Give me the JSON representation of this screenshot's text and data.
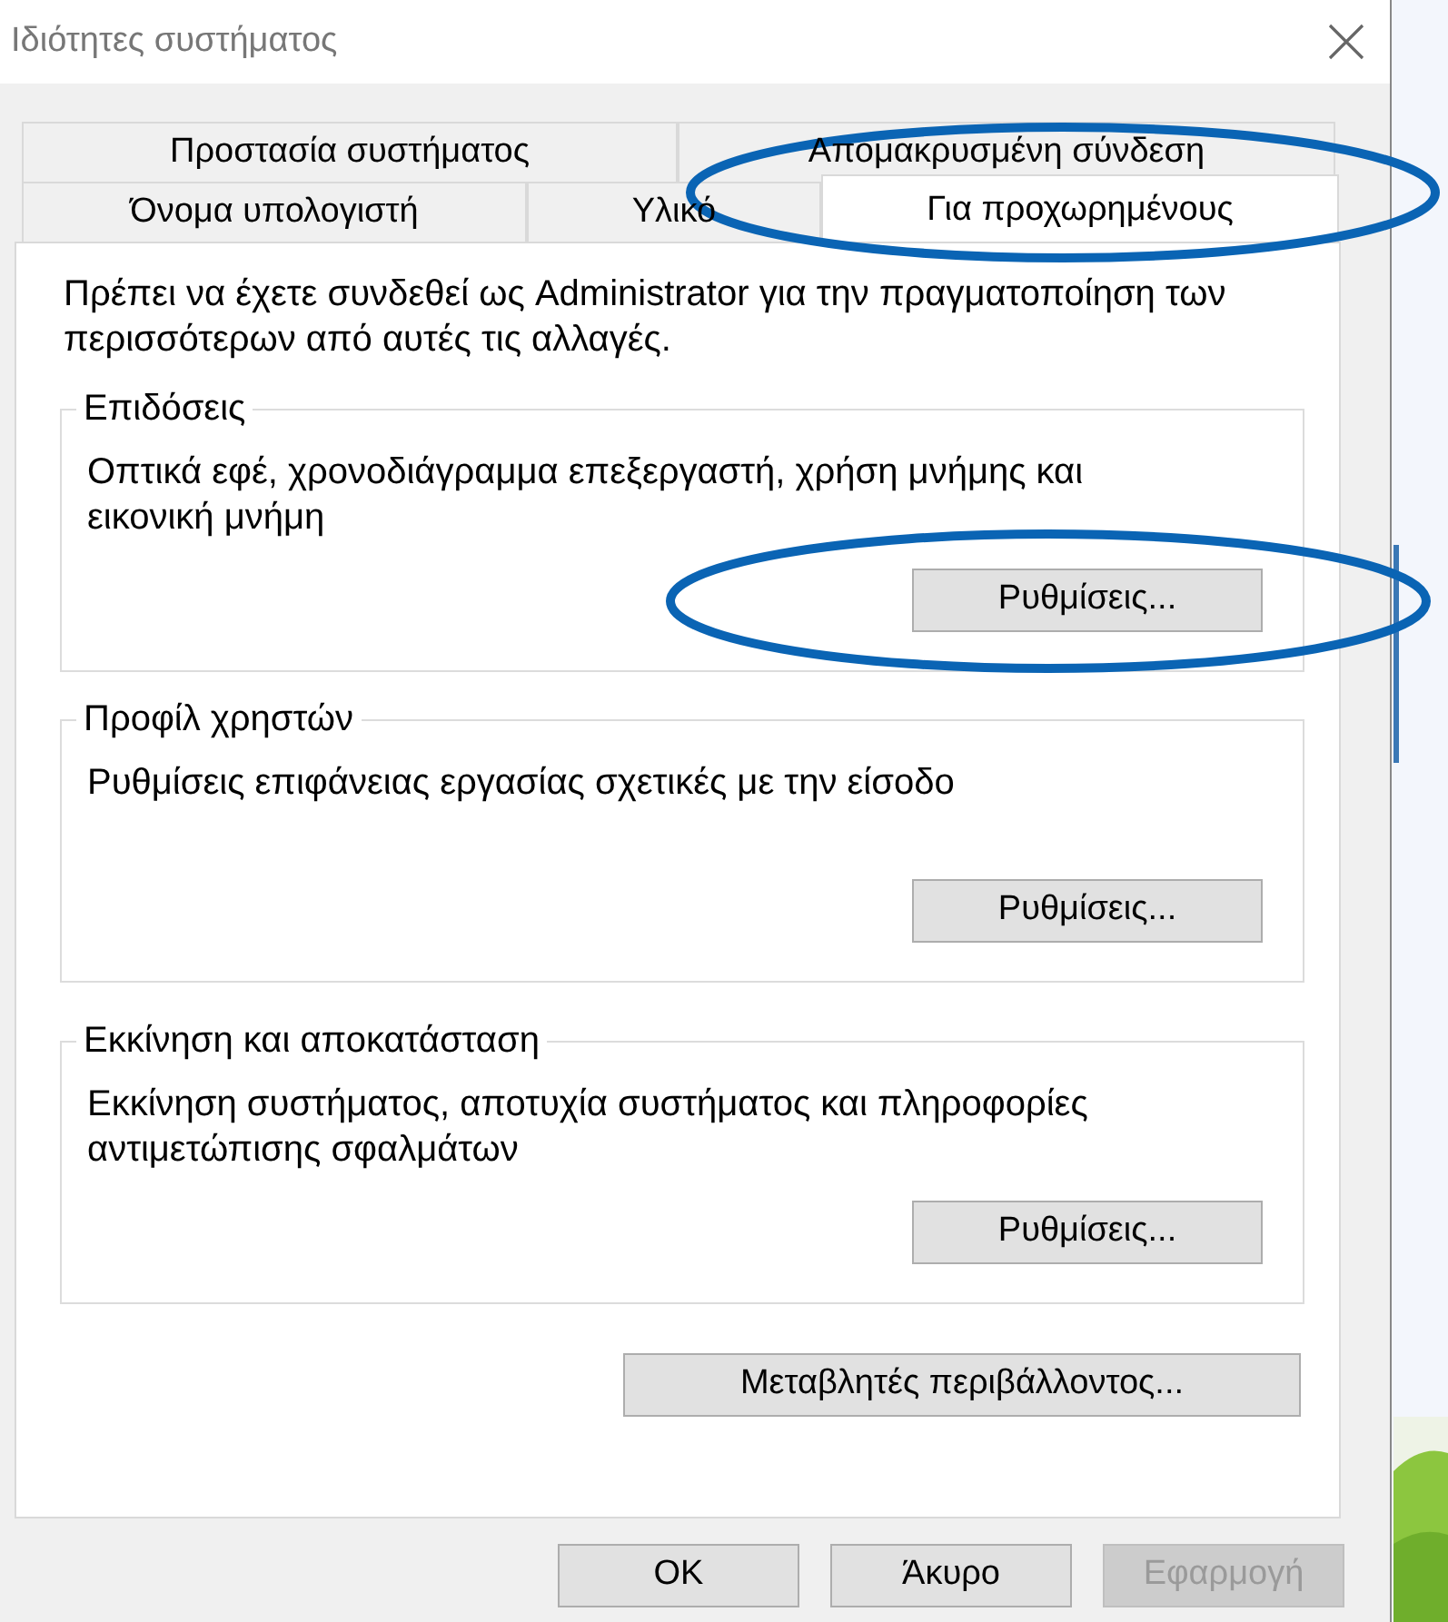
{
  "window": {
    "title": "Ιδιότητες συστήματος"
  },
  "tab_rows": [
    [
      {
        "label": "Προστασία συστήματος",
        "selected": false,
        "highlighted": false
      },
      {
        "label": "Απομακρυσμένη σύνδεση",
        "selected": false,
        "highlighted": false
      }
    ],
    [
      {
        "label": "Όνομα υπολογιστή",
        "selected": false,
        "highlighted": false
      },
      {
        "label": "Υλικό",
        "selected": false,
        "highlighted": false
      },
      {
        "label": "Για προχωρημένους",
        "selected": true,
        "highlighted": true
      }
    ]
  ],
  "intro": "Πρέπει να έχετε συνδεθεί ως Administrator για την πραγματοποίηση των περισσότερων από αυτές τις αλλαγές.",
  "groups": [
    {
      "title": "Επιδόσεις",
      "description": "Οπτικά εφέ, χρονοδιάγραμμα επεξεργαστή, χρήση μνήμης και εικονική μνήμη",
      "button": "Ρυθμίσεις...",
      "highlighted": true
    },
    {
      "title": "Προφίλ χρηστών",
      "description": "Ρυθμίσεις επιφάνειας εργασίας σχετικές με την είσοδο",
      "button": "Ρυθμίσεις...",
      "highlighted": false
    },
    {
      "title": "Εκκίνηση και αποκατάσταση",
      "description": "Εκκίνηση συστήματος, αποτυχία συστήματος και πληροφορίες αντιμετώπισης σφαλμάτων",
      "button": "Ρυθμίσεις...",
      "highlighted": false
    }
  ],
  "env_button": "Μεταβλητές περιβάλλοντος...",
  "buttons": [
    {
      "label": "OK",
      "disabled": false
    },
    {
      "label": "Άκυρο",
      "disabled": false
    },
    {
      "label": "Εφαρμογή",
      "disabled": true
    }
  ]
}
